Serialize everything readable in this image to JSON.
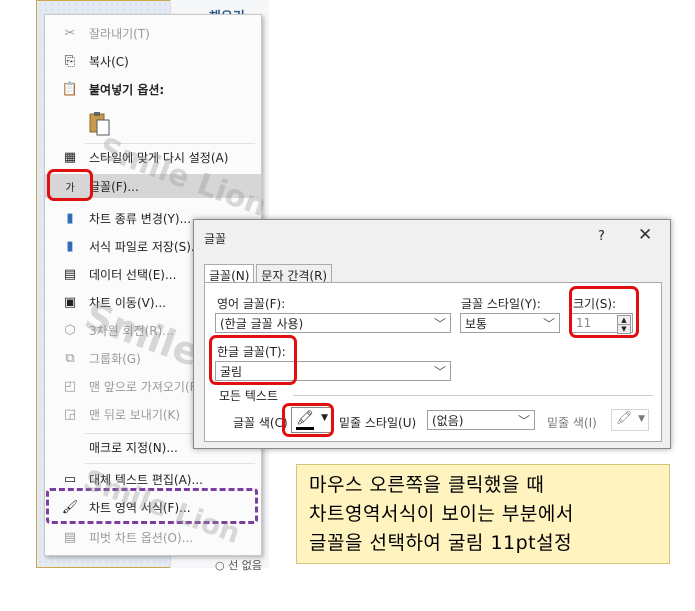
{
  "side_panel": {
    "tab_label": "채우기",
    "radio_label": "선 없음"
  },
  "context_menu": {
    "items": [
      {
        "label": "잘라내기(T)",
        "icon": "scissors-icon",
        "disabled": true
      },
      {
        "label": "복사(C)",
        "icon": "copy-icon",
        "disabled": false
      },
      {
        "label": "붙여넣기 옵션:",
        "icon": "paste-icon",
        "disabled": false
      },
      {
        "label": "스타일에 맞게 다시 설정(A)",
        "icon": "reset-style-icon",
        "disabled": false
      },
      {
        "label": "글꼴(F)...",
        "icon": "font-icon",
        "disabled": false,
        "highlighted": true
      },
      {
        "label": "차트 종류 변경(Y)...",
        "icon": "chart-type-icon",
        "disabled": false
      },
      {
        "label": "서식 파일로 저장(S)...",
        "icon": "save-template-icon",
        "disabled": false
      },
      {
        "label": "데이터 선택(E)...",
        "icon": "select-data-icon",
        "disabled": false
      },
      {
        "label": "차트 이동(V)...",
        "icon": "move-chart-icon",
        "disabled": false
      },
      {
        "label": "3차원 회전(R)...",
        "icon": "rotate-3d-icon",
        "disabled": true
      },
      {
        "label": "그룹화(G)",
        "icon": "group-icon",
        "disabled": true
      },
      {
        "label": "맨 앞으로 가져오기(R)",
        "icon": "bring-front-icon",
        "disabled": true
      },
      {
        "label": "맨 뒤로 보내기(K)",
        "icon": "send-back-icon",
        "disabled": true
      },
      {
        "label": "매크로 지정(N)...",
        "icon": "",
        "disabled": false
      },
      {
        "label": "대체 텍스트 편집(A)...",
        "icon": "alt-text-icon",
        "disabled": false
      },
      {
        "label": "차트 영역 서식(F)...",
        "icon": "format-area-icon",
        "disabled": false
      },
      {
        "label": "피벗 차트 옵션(O)...",
        "icon": "pivot-icon",
        "disabled": true
      }
    ],
    "font_icon_glyph": "가"
  },
  "font_dialog": {
    "title": "글꼴",
    "help": "?",
    "close": "✕",
    "tabs": [
      "글꼴(N)",
      "문자 간격(R)"
    ],
    "latin_font_label": "영어 글꼴(F):",
    "latin_font_value": "(한글 글꼴 사용)",
    "style_label": "글꼴 스타일(Y):",
    "style_value": "보통",
    "size_label": "크기(S):",
    "size_value": "11",
    "hangul_font_label": "한글 글꼴(T):",
    "hangul_font_value": "굴림",
    "all_text_label": "모든 텍스트",
    "font_color_label": "글꼴 색(C)",
    "underline_style_label": "밑줄 스타일(U)",
    "underline_style_value": "(없음)",
    "underline_color_label": "밑줄 색(I)"
  },
  "watermark": "Smile Lion",
  "note": {
    "lines": [
      "마우스 오른쪽을 클릭했을 때",
      "차트영역서식이 보이는 부분에서",
      "글꼴을 선택하여 굴림 11pt설정"
    ]
  },
  "colors": {
    "highlight_box": "#e01010",
    "dashed_box": "#7b3fa0",
    "note_bg": "#fff3bf"
  }
}
